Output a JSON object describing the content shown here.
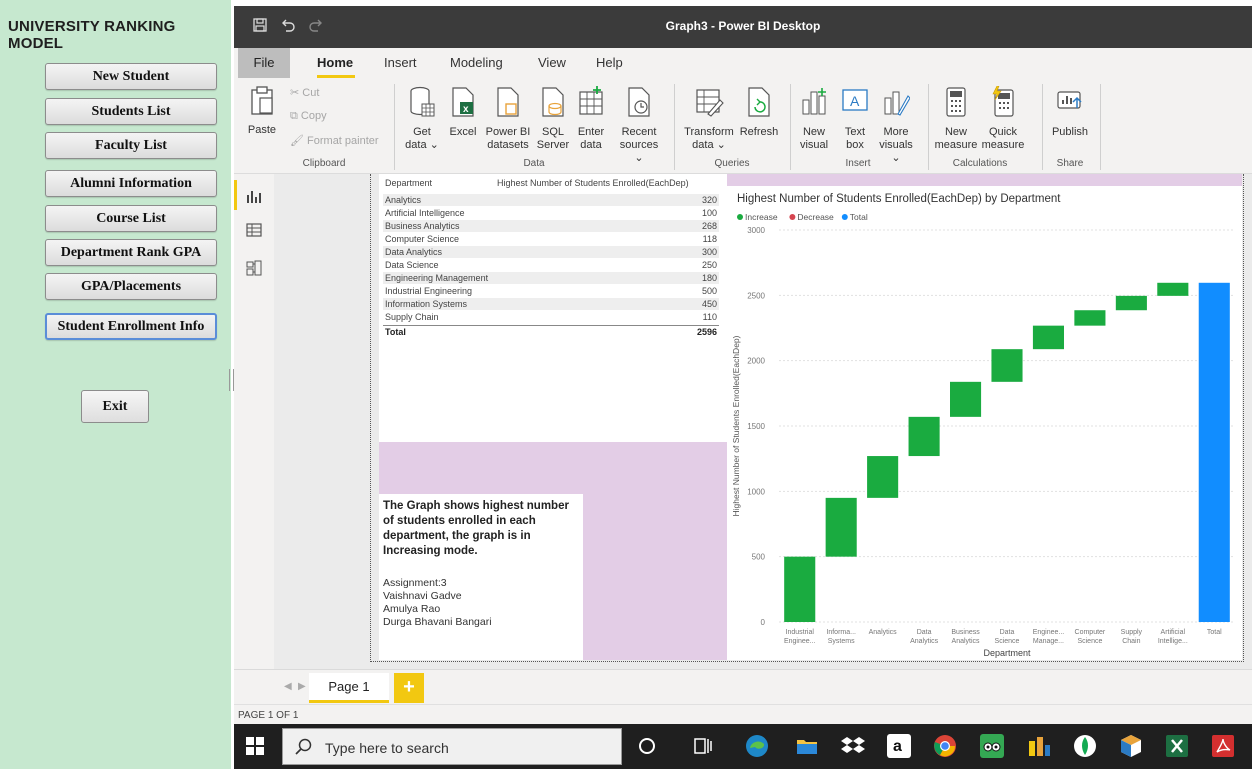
{
  "app": {
    "title": "UNIVERSITY RANKING MODEL",
    "nav": [
      "New Student",
      "Students List",
      "Faculty List",
      "Alumni Information",
      "Course List",
      "Department Rank GPA",
      "GPA/Placements",
      "Student Enrollment Info"
    ],
    "active_nav": "Student Enrollment Info",
    "exit_label": "Exit"
  },
  "window": {
    "title": "Graph3 - Power BI Desktop"
  },
  "menu": {
    "file": "File",
    "tabs": [
      "Home",
      "Insert",
      "Modeling",
      "View",
      "Help"
    ],
    "active_tab": "Home"
  },
  "ribbon": {
    "clipboard": {
      "paste": "Paste",
      "cut": "Cut",
      "copy": "Copy",
      "format_painter": "Format painter",
      "group": "Clipboard"
    },
    "data": {
      "get_data": [
        "Get",
        "data ⌄"
      ],
      "excel": "Excel",
      "power_bi_datasets": [
        "Power BI",
        "datasets"
      ],
      "sql_server": [
        "SQL",
        "Server"
      ],
      "enter_data": [
        "Enter",
        "data"
      ],
      "recent_sources": [
        "Recent",
        "sources ⌄"
      ],
      "group": "Data"
    },
    "queries": {
      "transform_data": [
        "Transform",
        "data ⌄"
      ],
      "refresh": "Refresh",
      "group": "Queries"
    },
    "insert": {
      "new_visual": [
        "New",
        "visual"
      ],
      "text_box": [
        "Text",
        "box"
      ],
      "more_visuals": [
        "More",
        "visuals ⌄"
      ],
      "group": "Insert"
    },
    "calculations": {
      "new_measure": [
        "New",
        "measure"
      ],
      "quick_measure": [
        "Quick",
        "measure"
      ],
      "group": "Calculations"
    },
    "share": {
      "publish": "Publish",
      "group": "Share"
    }
  },
  "table": {
    "headers": [
      "Department",
      "Highest Number of Students Enrolled(EachDep)"
    ],
    "rows": [
      [
        "Analytics",
        "320"
      ],
      [
        "Artificial Intelligence",
        "100"
      ],
      [
        "Business Analytics",
        "268"
      ],
      [
        "Computer Science",
        "118"
      ],
      [
        "Data Analytics",
        "300"
      ],
      [
        "Data Science",
        "250"
      ],
      [
        "Engineering Management",
        "180"
      ],
      [
        "Industrial Engineering",
        "500"
      ],
      [
        "Information Systems",
        "450"
      ],
      [
        "Supply Chain",
        "110"
      ]
    ],
    "total": [
      "Total",
      "2596"
    ]
  },
  "textbox": {
    "description": "The Graph shows highest number of students enrolled in each department, the graph is in Increasing mode.",
    "assignment": "Assignment:3",
    "authors": [
      "Vaishnavi Gadve",
      "Amulya Rao",
      "Durga Bhavani Bangari"
    ]
  },
  "chart_data": {
    "type": "bar",
    "subtype": "waterfall",
    "title": "Highest Number of Students Enrolled(EachDep) by Department",
    "xlabel": "Department",
    "ylabel": "Highest Number of Students Enrolled(EachDep)",
    "ylim": [
      0,
      3000
    ],
    "yticks": [
      0,
      500,
      1000,
      1500,
      2000,
      2500,
      3000
    ],
    "grid": true,
    "legend_position": "top-left",
    "legend": [
      {
        "name": "Increase",
        "color": "#1aab40"
      },
      {
        "name": "Decrease",
        "color": "#d64550"
      },
      {
        "name": "Total",
        "color": "#118dff"
      }
    ],
    "categories": [
      [
        "Industrial",
        "Enginee..."
      ],
      [
        "Informa...",
        "Systems"
      ],
      [
        "Analytics"
      ],
      [
        "Data",
        "Analytics"
      ],
      [
        "Business",
        "Analytics"
      ],
      [
        "Data",
        "Science"
      ],
      [
        "Enginee...",
        "Manage..."
      ],
      [
        "Computer",
        "Science"
      ],
      [
        "Supply",
        "Chain"
      ],
      [
        "Artificial",
        "Intellige..."
      ],
      [
        "Total"
      ]
    ],
    "values": [
      500,
      450,
      320,
      300,
      268,
      250,
      180,
      118,
      110,
      100,
      2596
    ]
  },
  "pages": {
    "tab": "Page 1",
    "add": "+",
    "status": "PAGE 1 OF 1"
  },
  "taskbar": {
    "search_placeholder": "Type here to search",
    "icons": [
      "cortana-icon",
      "task-view-icon",
      "edge-icon",
      "file-explorer-icon",
      "dropbox-icon",
      "amazon-icon",
      "chrome-icon",
      "tripadvisor-icon",
      "power-bi-icon",
      "mongodb-icon",
      "app-icon",
      "excel-icon",
      "acrobat-icon"
    ]
  }
}
